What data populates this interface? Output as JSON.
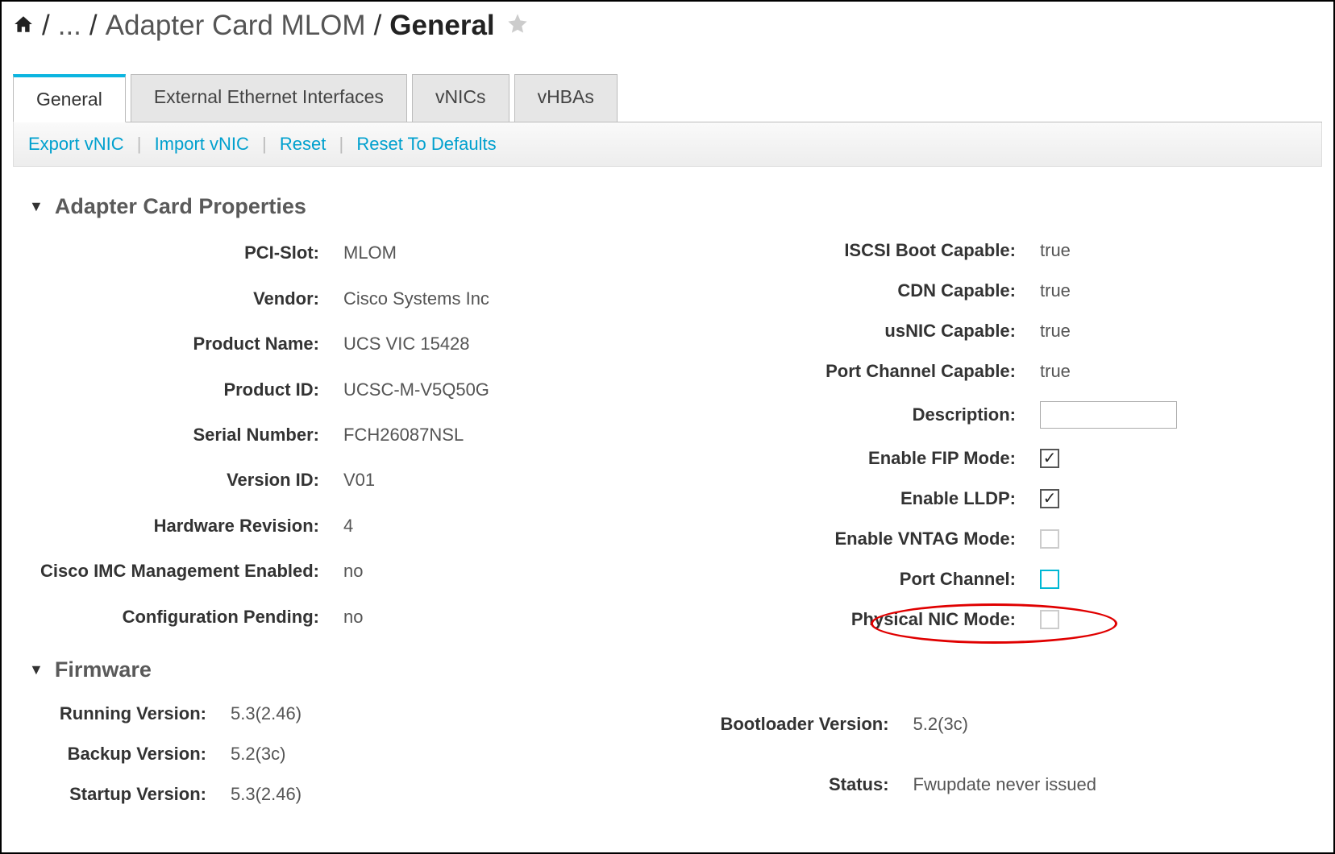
{
  "breadcrumb": {
    "prev": "Adapter Card MLOM",
    "current": "General"
  },
  "tabs": [
    "General",
    "External Ethernet Interfaces",
    "vNICs",
    "vHBAs"
  ],
  "actions": [
    "Export vNIC",
    "Import vNIC",
    "Reset",
    "Reset To Defaults"
  ],
  "sections": {
    "adapter": {
      "title": "Adapter Card Properties",
      "left": {
        "pci_slot_label": "PCI-Slot:",
        "pci_slot": "MLOM",
        "vendor_label": "Vendor:",
        "vendor": "Cisco Systems Inc",
        "product_name_label": "Product Name:",
        "product_name": "UCS VIC 15428",
        "product_id_label": "Product ID:",
        "product_id": "UCSC-M-V5Q50G",
        "serial_label": "Serial Number:",
        "serial": "FCH26087NSL",
        "version_id_label": "Version ID:",
        "version_id": "V01",
        "hw_rev_label": "Hardware Revision:",
        "hw_rev": "4",
        "imc_label": "Cisco IMC Management Enabled:",
        "imc": "no",
        "cfg_pending_label": "Configuration Pending:",
        "cfg_pending": "no"
      },
      "right": {
        "iscsi_label": "ISCSI Boot Capable:",
        "iscsi": "true",
        "cdn_label": "CDN Capable:",
        "cdn": "true",
        "usnic_label": "usNIC Capable:",
        "usnic": "true",
        "pcc_label": "Port Channel Capable:",
        "pcc": "true",
        "desc_label": "Description:",
        "fip_label": "Enable FIP Mode:",
        "lldp_label": "Enable LLDP:",
        "vntag_label": "Enable VNTAG Mode:",
        "portch_label": "Port Channel:",
        "pnic_label": "Physical NIC Mode:"
      }
    },
    "firmware": {
      "title": "Firmware",
      "left": {
        "running_label": "Running Version:",
        "running": "5.3(2.46)",
        "backup_label": "Backup Version:",
        "backup": "5.2(3c)",
        "startup_label": "Startup Version:",
        "startup": "5.3(2.46)"
      },
      "right": {
        "boot_label": "Bootloader Version:",
        "boot": "5.2(3c)",
        "status_label": "Status:",
        "status": "Fwupdate never issued"
      }
    }
  }
}
